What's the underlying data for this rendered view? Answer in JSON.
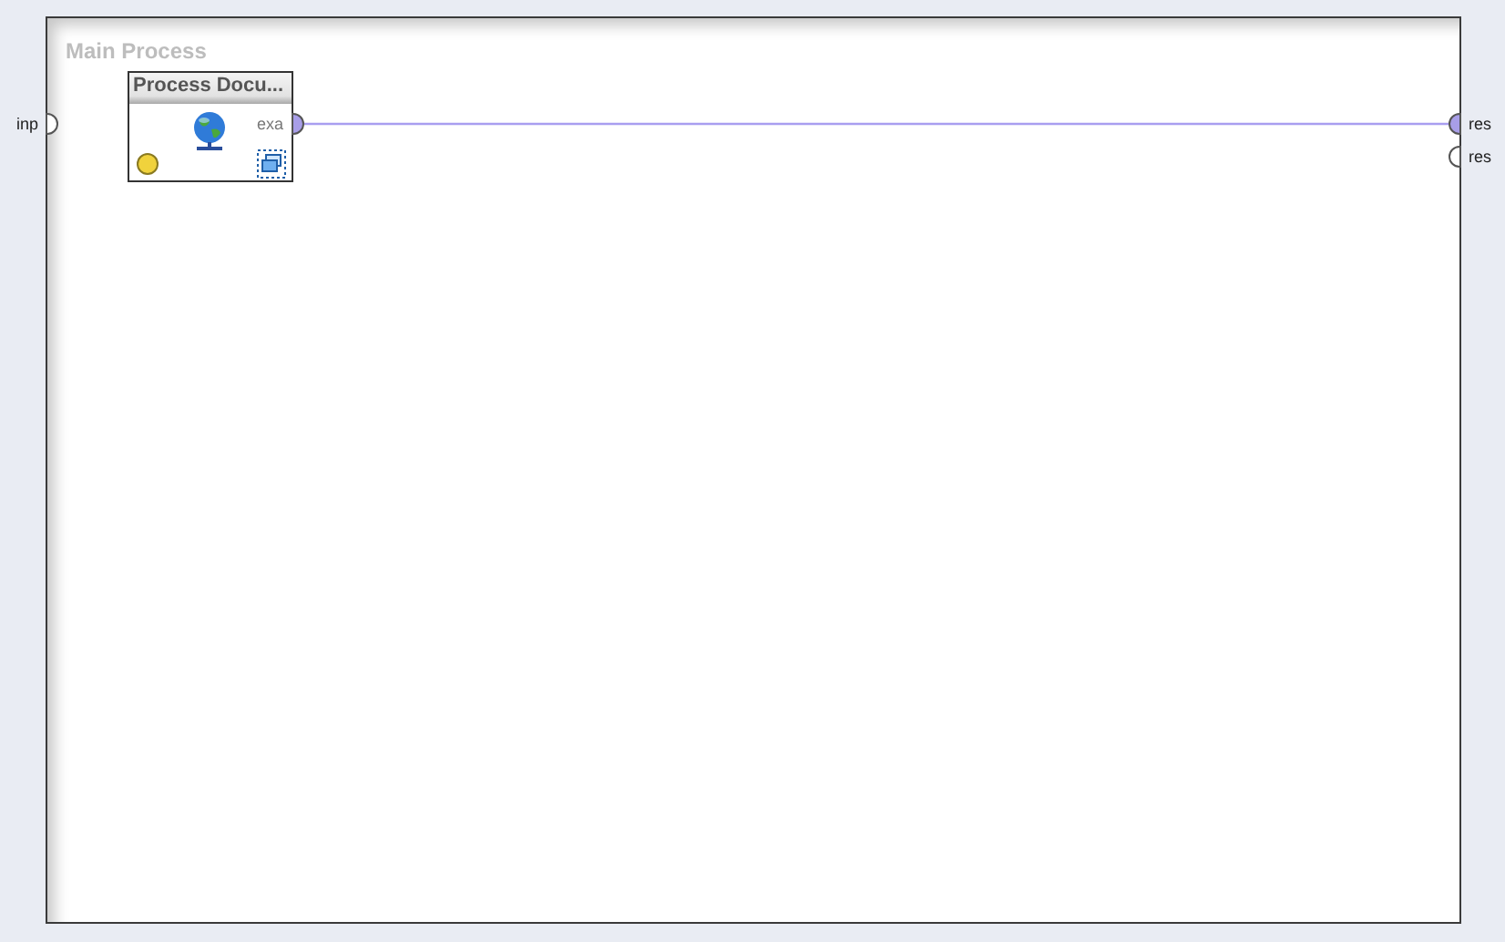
{
  "process": {
    "title": "Main Process",
    "input_ports": [
      {
        "label": "inp",
        "connected": false
      }
    ],
    "operators": [
      {
        "name": "Process Docu...",
        "color": "#f0d23c",
        "output_ports": [
          {
            "label": "exa",
            "connected": true
          }
        ]
      }
    ],
    "output_ports": [
      {
        "label": "res",
        "connected": true
      },
      {
        "label": "res",
        "connected": false
      }
    ]
  }
}
